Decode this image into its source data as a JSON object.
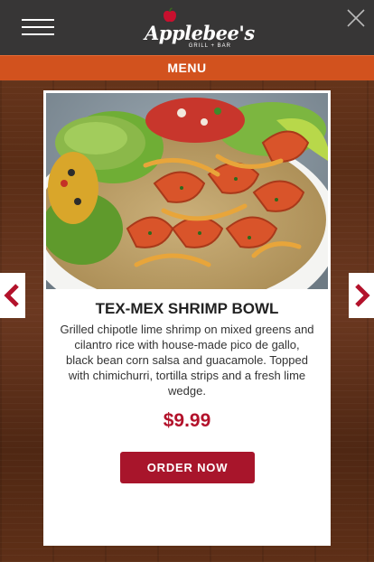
{
  "header": {
    "brand_name": "Applebee's",
    "brand_sub": "GRILL + BAR",
    "menu_icon": "hamburger-icon",
    "close_icon": "close-icon"
  },
  "nav": {
    "menu_label": "MENU"
  },
  "carousel": {
    "prev_icon": "chevron-left-icon",
    "next_icon": "chevron-right-icon"
  },
  "item": {
    "title": "TEX-MEX SHRIMP BOWL",
    "description": "Grilled chipotle lime shrimp on mixed greens and cilantro rice with house-made pico de gallo, black bean corn salsa and guacamole. Topped with chimichurri, tortilla strips and a fresh lime wedge.",
    "price": "$9.99",
    "cta_label": "ORDER NOW"
  },
  "colors": {
    "header_bg": "#373636",
    "menu_bar": "#d2521e",
    "accent_red": "#a8152b",
    "price_red": "#b3122b"
  }
}
